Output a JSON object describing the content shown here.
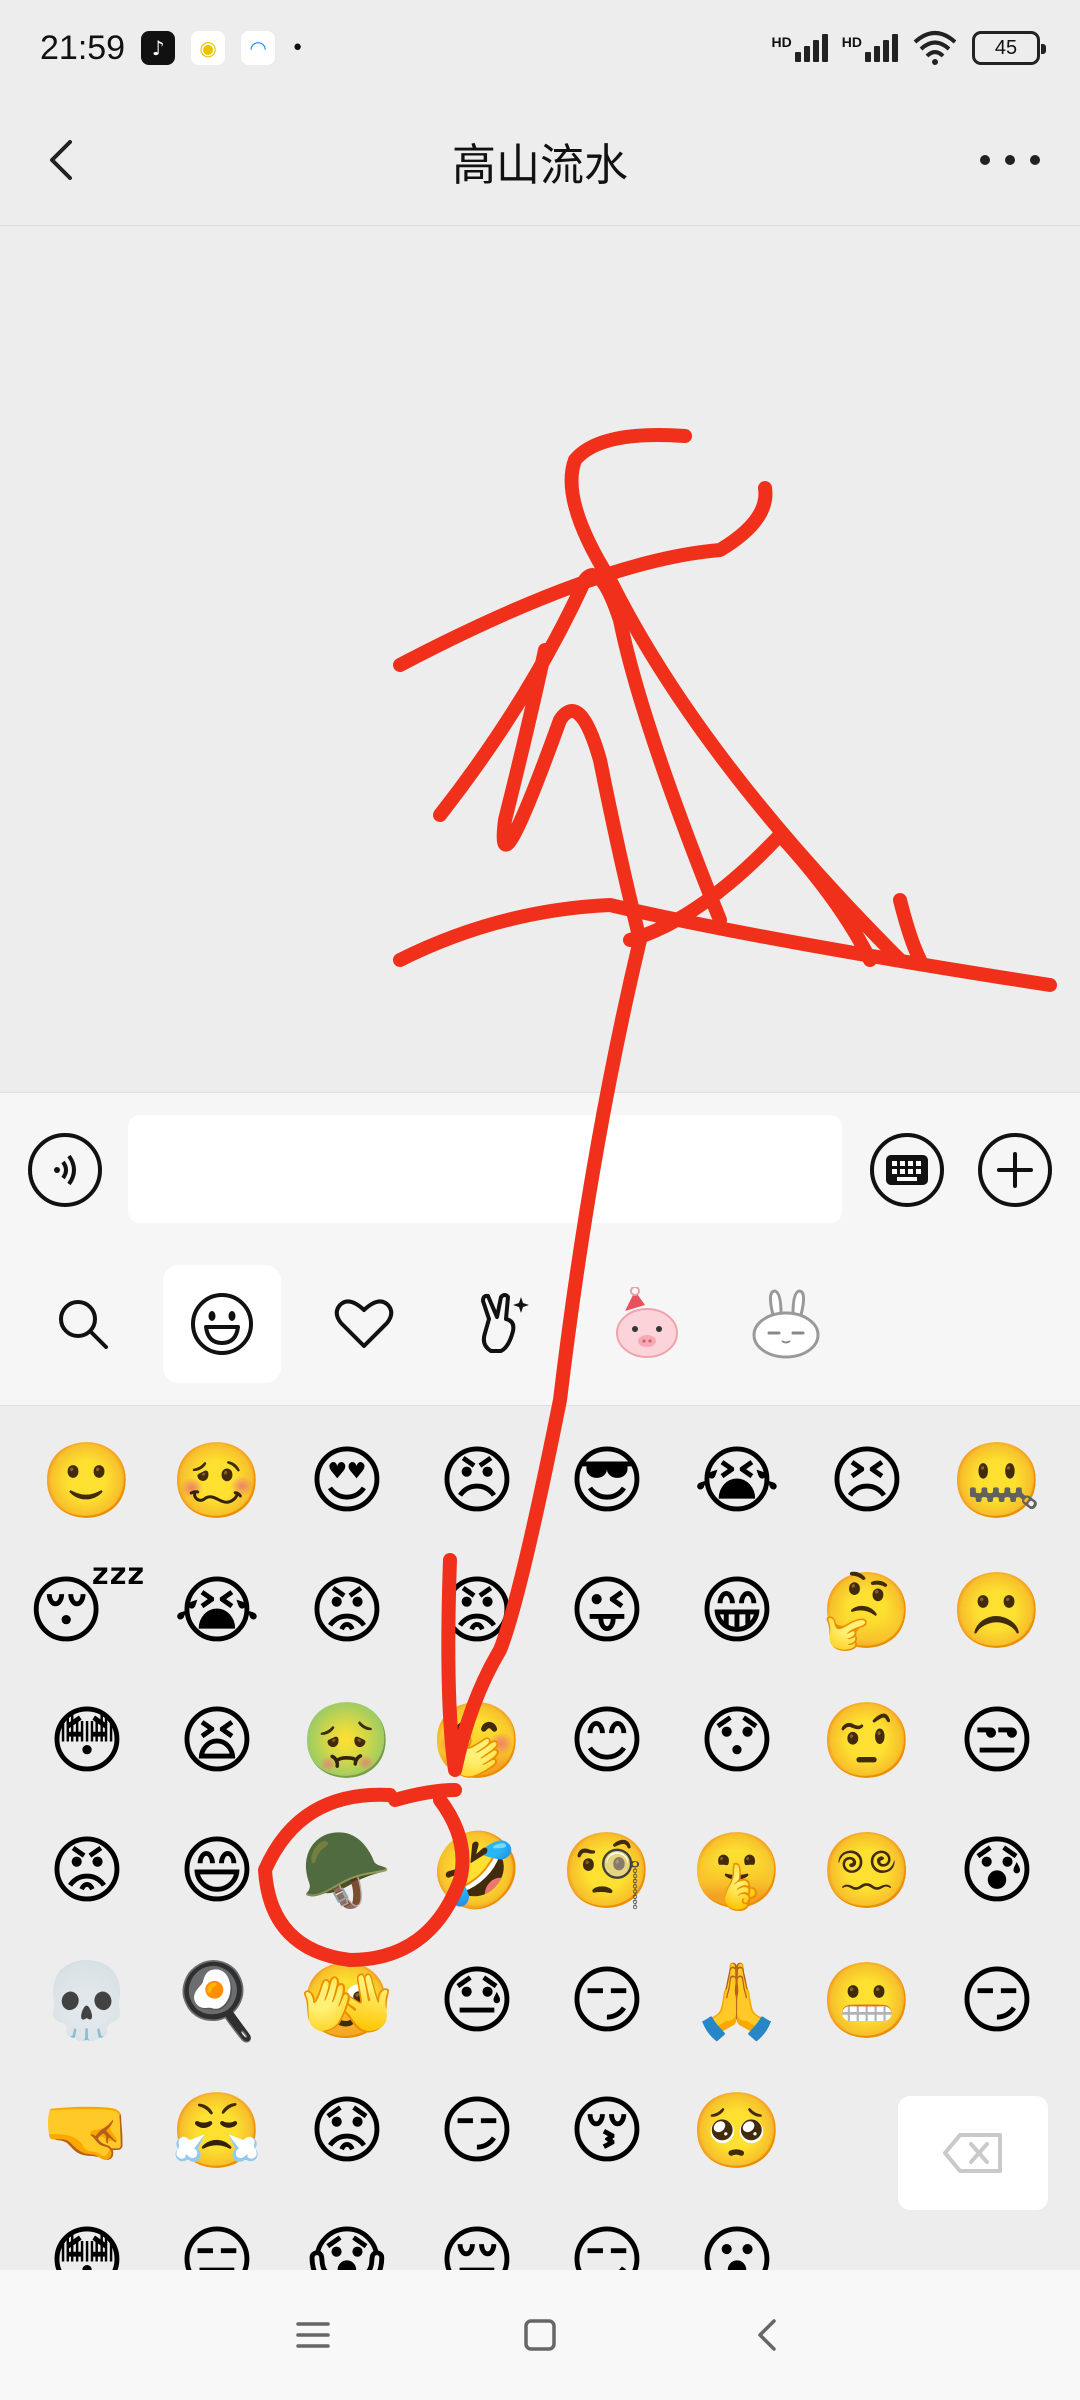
{
  "status_bar": {
    "time": "21:59",
    "signal_1_label": "HD",
    "signal_2_label": "HD",
    "battery": "45",
    "app_icons": [
      "douyin-icon",
      "qq-music-icon",
      "loop-app-icon"
    ],
    "more_indicator": "•"
  },
  "header": {
    "title": "高山流水",
    "back_icon": "chevron-left-icon",
    "more_icon": "more-dots-icon"
  },
  "input_bar": {
    "voice_icon": "voice-icon",
    "text_value": "",
    "keyboard_icon": "keyboard-icon",
    "plus_icon": "plus-icon"
  },
  "sticker_tabs": [
    {
      "icon": "search-icon",
      "active": false
    },
    {
      "icon": "smiley-icon",
      "active": true
    },
    {
      "icon": "heart-icon",
      "active": false
    },
    {
      "icon": "sparkle-hand-icon",
      "active": false
    },
    {
      "icon": "pink-pig-sticker-icon",
      "active": false
    },
    {
      "icon": "bunny-sticker-icon",
      "active": false
    }
  ],
  "emoji_rows": [
    [
      "🙂",
      "🥴",
      "😍",
      "😠",
      "😎",
      "😭",
      "😣",
      "🤐"
    ],
    [
      "😴",
      "😭",
      "😡",
      "😡",
      "😜",
      "😁",
      "🤔",
      "☹️"
    ],
    [
      "😳",
      "😫",
      "🤢",
      "🤭",
      "😊",
      "😯",
      "🤨",
      "😒"
    ],
    [
      "😡",
      "😄",
      "🪖",
      "🤣",
      "🧐",
      "🤫",
      "😵‍💫",
      "😰"
    ],
    [
      "💀",
      "🍳",
      "🫣",
      "😓",
      "😏",
      "🙏",
      "😬",
      "😏"
    ],
    [
      "🤜",
      "😤",
      "😟",
      "😏",
      "😚",
      "🥺"
    ],
    [
      "😳",
      "😑",
      "😱",
      "😔",
      "😏",
      "😮"
    ]
  ],
  "backspace_icon": "backspace-icon",
  "nav_bar": {
    "menu_icon": "menu-icon",
    "home_icon": "home-square-icon",
    "back_icon": "back-triangle-icon"
  },
  "annotation_color": "#f0301a"
}
